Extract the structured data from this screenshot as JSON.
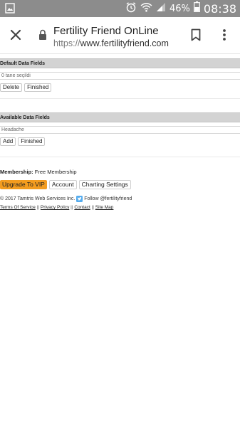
{
  "status_bar": {
    "battery": "46%",
    "time": "08:38"
  },
  "browser": {
    "title": "Fertility Friend OnLine",
    "url_scheme": "https://",
    "url_host": "www.fertilityfriend.com"
  },
  "default_fields": {
    "header": "Default Data Fields",
    "input_value": "0 tane seçildi",
    "delete_label": "Delete",
    "finished_label": "Finished"
  },
  "available_fields": {
    "header": "Available Data Fields",
    "input_value": "Headache",
    "add_label": "Add",
    "finished_label": "Finished"
  },
  "membership": {
    "label": "Membership:",
    "value": "Free Membership"
  },
  "actions": {
    "vip_label": "Upgrade To VIP",
    "account_label": "Account",
    "charting_label": "Charting Settings"
  },
  "footer": {
    "copyright": "© 2017 Tamtris Web Services Inc.",
    "follow": "Follow @fertilityfriend",
    "links": [
      "Terms Of Service",
      "Privacy Policy",
      "Contact",
      "Site Map"
    ],
    "separator": "||"
  },
  "colors": {
    "status_bar_bg": "#8c8c8c",
    "vip_button_bg": "#f39c1f",
    "section_header_bg": "#d3d3d3",
    "twitter_blue": "#55acee"
  }
}
